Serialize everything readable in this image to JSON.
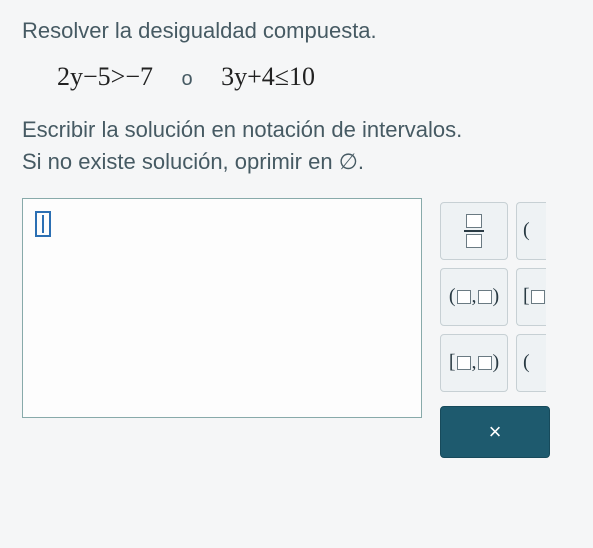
{
  "heading": "Resolver la desigualdad compuesta.",
  "equations": {
    "left": "2y−5>−7",
    "or_label": "o",
    "right": "3y+4≤10"
  },
  "instruction_line1": "Escribir la solución en notación de intervalos.",
  "instruction_line2_prefix": "Si no existe solución, oprimir en ",
  "instruction_line2_symbol": "∅",
  "instruction_line2_suffix": ".",
  "answer_value": "",
  "palette": {
    "fraction_label": "fraction",
    "open_open": "(□,□)",
    "closed_open_partial": "[□",
    "closed_open": "[□,□)",
    "partial_right": "("
  },
  "close_label": "×"
}
